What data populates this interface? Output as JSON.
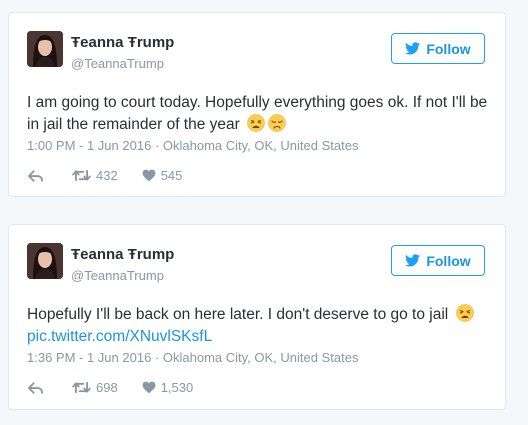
{
  "tweets": [
    {
      "author": {
        "name": "Ŧeanna Ŧrump",
        "handle": "@TeannaTrump"
      },
      "follow_label": "Follow",
      "text": "I am going to court today. Hopefully everything goes ok. If not I'll be in jail the remainder of the year",
      "emojis": [
        "tired-face-emoji",
        "disappointed-face-emoji"
      ],
      "link": "",
      "timestamp": "1:00 PM - 1 Jun 2016",
      "location": "Oklahoma City, OK, United States",
      "retweets": "432",
      "likes": "545"
    },
    {
      "author": {
        "name": "Ŧeanna Ŧrump",
        "handle": "@TeannaTrump"
      },
      "follow_label": "Follow",
      "text": "Hopefully I'll be back on here later. I don't deserve to go to jail",
      "emojis": [
        "tired-face-emoji"
      ],
      "link": "pic.twitter.com/XNuvlSKsfL",
      "timestamp": "1:36 PM - 1 Jun 2016",
      "location": "Oklahoma City, OK, United States",
      "retweets": "698",
      "likes": "1,530"
    }
  ],
  "icons": {
    "follow": "twitter-bird-icon",
    "reply": "reply-icon",
    "retweet": "retweet-icon",
    "like": "heart-icon"
  },
  "colors": {
    "accent": "#1da1f2",
    "link": "#1b95e0",
    "muted": "#8899a6",
    "text": "#292f33",
    "border": "#e1e8ed",
    "background": "#f5f8fa",
    "emoji": "#ffcc4d"
  }
}
